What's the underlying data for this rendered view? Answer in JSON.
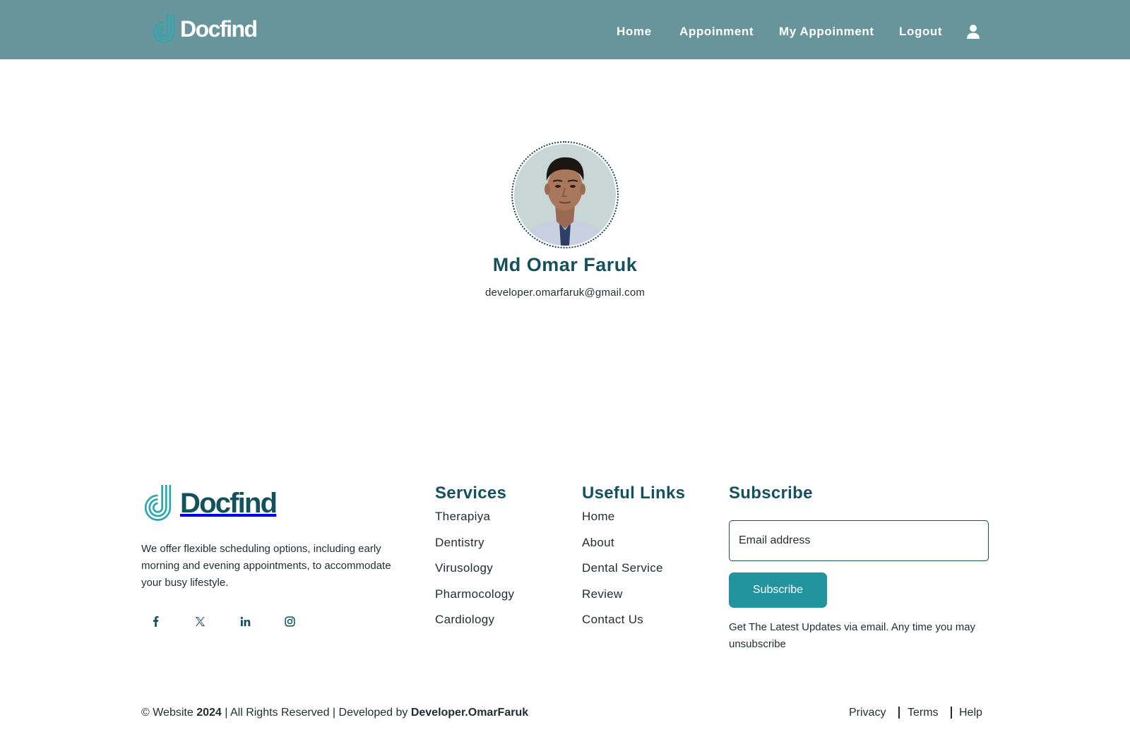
{
  "header": {
    "brand": "Docfind",
    "nav": [
      {
        "label": "Home"
      },
      {
        "label": "Appoinment"
      },
      {
        "label": "My Appoinment"
      },
      {
        "label": "Logout"
      }
    ],
    "user_icon": "user-icon"
  },
  "profile": {
    "name": "Md Omar Faruk",
    "email": "developer.omarfaruk@gmail.com"
  },
  "footer": {
    "brand": "Docfind",
    "description": "We offer flexible scheduling options, including early morning and evening appointments, to accommodate your busy lifestyle.",
    "socials": [
      "facebook-icon",
      "x-icon",
      "linkedin-icon",
      "instagram-icon"
    ],
    "services": {
      "title": "Services",
      "items": [
        "Therapiya",
        "Dentistry",
        "Virusology",
        "Pharmocology",
        "Cardiology"
      ]
    },
    "useful_links": {
      "title": "Useful Links",
      "items": [
        "Home",
        "About",
        "Dental Service",
        "Review",
        "Contact Us"
      ]
    },
    "subscribe": {
      "title": "Subscribe",
      "input_placeholder": "Email address",
      "button": "Subscribe",
      "note": "Get The Latest Updates via email. Any time you may unsubscribe"
    }
  },
  "bottom": {
    "copyright_prefix": "© Website",
    "year": "2024",
    "copyright_middle": "| All Rights Reserved | Developed by",
    "developer": "Developer.OmarFaruk",
    "links": [
      "Privacy",
      "Terms",
      "Help"
    ]
  },
  "colors": {
    "header_bg": "#68959b",
    "primary_dark": "#14515e",
    "accent": "#21949f",
    "logo_teal": "#2aa8b0"
  }
}
